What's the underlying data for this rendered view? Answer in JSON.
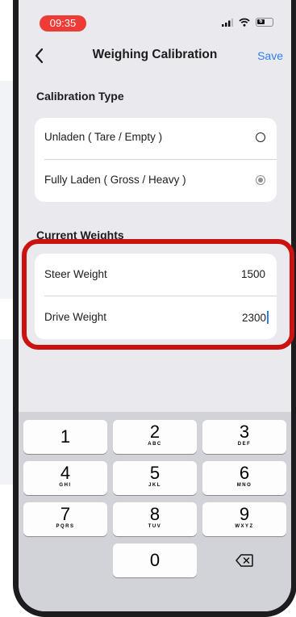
{
  "status_bar": {
    "time": "09:35",
    "battery": "6"
  },
  "nav": {
    "title": "Weighing Calibration",
    "save_label": "Save"
  },
  "calibration_type": {
    "title": "Calibration Type",
    "options": [
      {
        "label": "Unladen ( Tare / Empty )",
        "selected": false
      },
      {
        "label": "Fully Laden ( Gross / Heavy )",
        "selected": true
      }
    ]
  },
  "current_weights": {
    "title": "Current Weights",
    "fields": [
      {
        "label": "Steer Weight",
        "value": "1500"
      },
      {
        "label": "Drive Weight",
        "value": "2300"
      }
    ]
  },
  "keypad": {
    "keys": [
      {
        "digit": "1",
        "letters": ""
      },
      {
        "digit": "2",
        "letters": "ABC"
      },
      {
        "digit": "3",
        "letters": "DEF"
      },
      {
        "digit": "4",
        "letters": "GHI"
      },
      {
        "digit": "5",
        "letters": "JKL"
      },
      {
        "digit": "6",
        "letters": "MNO"
      },
      {
        "digit": "7",
        "letters": "PQRS"
      },
      {
        "digit": "8",
        "letters": "TUV"
      },
      {
        "digit": "9",
        "letters": "WXYZ"
      },
      {
        "digit": "0",
        "letters": ""
      }
    ],
    "delete_icon": "delete-backspace-icon"
  },
  "colors": {
    "accent": "#2e7cf6",
    "highlight": "#cc1111",
    "status_pill": "#ee3b36"
  }
}
